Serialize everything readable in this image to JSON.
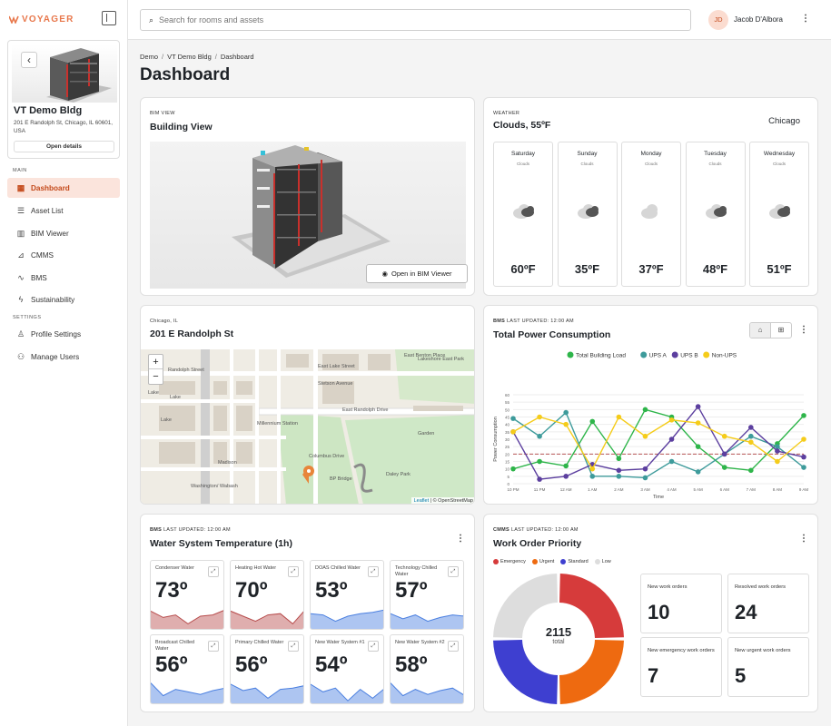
{
  "app": {
    "logo": "VOYAGER",
    "collapse_icon": "sidebar-collapse-icon"
  },
  "building_card": {
    "name": "VT Demo Bldg",
    "address": "201 E Randolph St, Chicago, IL 60601, USA",
    "open_label": "Open details"
  },
  "sidebar": {
    "main_label": "MAIN",
    "settings_label": "SETTINGS",
    "items": [
      {
        "label": "Dashboard",
        "icon": "dashboard-icon",
        "active": true
      },
      {
        "label": "Asset List",
        "icon": "list-icon"
      },
      {
        "label": "BIM Viewer",
        "icon": "building-icon"
      },
      {
        "label": "CMMS",
        "icon": "chart-icon"
      },
      {
        "label": "BMS",
        "icon": "pulse-icon"
      },
      {
        "label": "Sustainability",
        "icon": "bolt-icon"
      }
    ],
    "settings_items": [
      {
        "label": "Profile Settings",
        "icon": "user-icon"
      },
      {
        "label": "Manage Users",
        "icon": "users-icon"
      }
    ]
  },
  "header": {
    "search_placeholder": "Search for rooms and assets",
    "user_initials": "JD",
    "user_name": "Jacob D'Albora"
  },
  "breadcrumb": [
    "Demo",
    "VT Demo Bldg",
    "Dashboard"
  ],
  "page_title": "Dashboard",
  "bim": {
    "eyebrow": "BIM VIEW",
    "title": "Building View",
    "button": "Open in BIM Viewer"
  },
  "weather": {
    "eyebrow": "WEATHER",
    "title": "Clouds, 55ºF",
    "city": "Chicago",
    "days": [
      {
        "day": "Saturday",
        "cond": "Clouds",
        "temp": "60ºF",
        "icon": "rain-cloud-icon"
      },
      {
        "day": "Sunday",
        "cond": "Clouds",
        "temp": "35ºF",
        "icon": "rain-cloud-icon"
      },
      {
        "day": "Monday",
        "cond": "Clouds",
        "temp": "37ºF",
        "icon": "cloud-icon"
      },
      {
        "day": "Tuesday",
        "cond": "Clouds",
        "temp": "48ºF",
        "icon": "rain-cloud-icon"
      },
      {
        "day": "Wednesday",
        "cond": "Clouds",
        "temp": "51ºF",
        "icon": "rain-cloud-icon"
      }
    ]
  },
  "map": {
    "eyebrow": "Chicago, IL",
    "title": "201 E Randolph St",
    "attribution_link": "Leaflet",
    "attribution_rest": "| © OpenStreetMap",
    "labels": [
      "Randolph Street",
      "Lake",
      "Lake",
      "Millennium Station",
      "Washington/ Wabash",
      "BP Bridge",
      "East Randolph Drive",
      "East Lake Street",
      "Daley Park",
      "Lakeshore East Park",
      "Garden",
      "Madison",
      "Lake",
      "Columbus Drive",
      "Stetson Avenue",
      "East Benton Place"
    ]
  },
  "power": {
    "eyebrow_bold": "BMS",
    "eyebrow": "LAST UPDATED: 12:00 AM",
    "title": "Total Power Consumption"
  },
  "chart_data": {
    "type": "line",
    "x": [
      "10 PM",
      "11 PM",
      "12 AM",
      "1 AM",
      "2 AM",
      "3 AM",
      "4 AM",
      "5 AM",
      "6 AM",
      "7 AM",
      "8 AM",
      "9 AM"
    ],
    "series": [
      {
        "name": "Total Building Load",
        "color": "#2eb54a",
        "values": [
          10,
          15,
          12,
          42,
          17,
          50,
          45,
          25,
          11,
          9,
          27,
          46
        ]
      },
      {
        "name": "UPS A",
        "color": "#3e9b9b",
        "values": [
          44,
          32,
          48,
          5,
          5,
          4,
          15,
          8,
          20,
          32,
          25,
          11
        ]
      },
      {
        "name": "UPS B",
        "color": "#5c3f9f",
        "values": [
          35,
          3,
          5,
          13,
          9,
          10,
          30,
          52,
          20,
          38,
          22,
          18
        ]
      },
      {
        "name": "Non-UPS",
        "color": "#f5cc1a",
        "values": [
          35,
          45,
          40,
          10,
          45,
          32,
          43,
          41,
          32,
          28,
          15,
          30
        ]
      }
    ],
    "ylabel": "Power Consumption",
    "xlabel": "Time",
    "ylim": [
      0,
      60
    ],
    "yticks": [
      0,
      5,
      10,
      15,
      20,
      25,
      30,
      35,
      40,
      45,
      50,
      55,
      60
    ],
    "threshold": 20,
    "legend": "top"
  },
  "water": {
    "eyebrow_bold": "BMS",
    "eyebrow": "LAST UPDATED: 12:00 AM",
    "title": "Water System Temperature (1h)",
    "tiles": [
      {
        "name": "Condenser Water",
        "value": "73º",
        "trend": [
          0.7,
          0.45,
          0.55,
          0.2,
          0.5,
          0.55,
          0.75
        ],
        "color": "#b74c4c"
      },
      {
        "name": "Heating Hot Water",
        "value": "70º",
        "trend": [
          0.7,
          0.5,
          0.3,
          0.55,
          0.6,
          0.2,
          0.75
        ],
        "color": "#b74c4c"
      },
      {
        "name": "DOAS Chilled Water",
        "value": "53º",
        "trend": [
          0.6,
          0.55,
          0.3,
          0.5,
          0.6,
          0.65,
          0.75
        ],
        "color": "#4a7fe0"
      },
      {
        "name": "Technology Chilled Water",
        "value": "57º",
        "trend": [
          0.6,
          0.4,
          0.55,
          0.3,
          0.45,
          0.55,
          0.5
        ],
        "color": "#4a7fe0"
      },
      {
        "name": "Broadcast Chilled Water",
        "value": "56º",
        "trend": [
          0.8,
          0.3,
          0.55,
          0.45,
          0.35,
          0.5,
          0.6
        ],
        "color": "#4a7fe0"
      },
      {
        "name": "Primary Chilled Water",
        "value": "56º",
        "trend": [
          0.75,
          0.5,
          0.6,
          0.2,
          0.55,
          0.6,
          0.7
        ],
        "color": "#4a7fe0"
      },
      {
        "name": "New Water System #1",
        "value": "54º",
        "trend": [
          0.75,
          0.45,
          0.6,
          0.1,
          0.55,
          0.2,
          0.6
        ],
        "color": "#4a7fe0"
      },
      {
        "name": "New Water System #2",
        "value": "58º",
        "trend": [
          0.8,
          0.3,
          0.55,
          0.35,
          0.5,
          0.6,
          0.3
        ],
        "color": "#4a7fe0"
      }
    ]
  },
  "work": {
    "eyebrow_bold": "CMMS",
    "eyebrow": "LAST UPDATED: 12:00 AM",
    "title": "Work Order Priority",
    "legend": [
      {
        "name": "Emergency",
        "color": "#d63b3b"
      },
      {
        "name": "Urgent",
        "color": "#ee6a10"
      },
      {
        "name": "Standard",
        "color": "#3e3fd0"
      },
      {
        "name": "Low",
        "color": "#dddddd"
      }
    ],
    "donut": {
      "total": "2115",
      "total_label": "total",
      "slices": [
        0.25,
        0.25,
        0.25,
        0.25
      ]
    },
    "stats": [
      {
        "label": "New work orders",
        "value": "10"
      },
      {
        "label": "Resolved work orders",
        "value": "24"
      },
      {
        "label": "New emergency work orders",
        "value": "7"
      },
      {
        "label": "New urgent work orders",
        "value": "5"
      }
    ]
  }
}
